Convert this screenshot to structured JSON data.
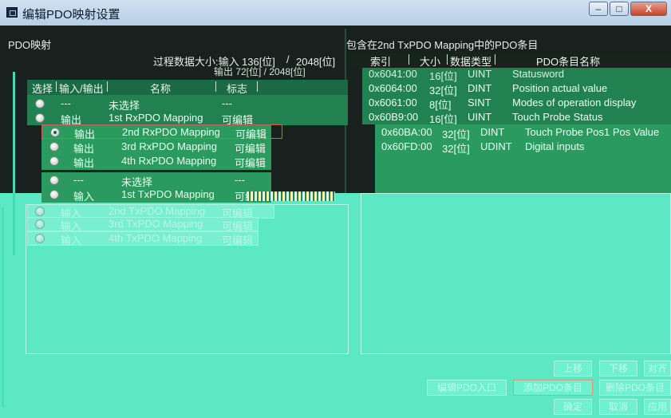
{
  "window": {
    "title": "编辑PDO映射设置",
    "buttons": {
      "minimize": "–",
      "maximize": "□",
      "close": "X"
    }
  },
  "left": {
    "header": "PDO映射",
    "size_label": "过程数据大小:输入",
    "size_value": "136[位]",
    "size_sep": "/",
    "size_max": "2048[位]",
    "overlap_text": "输出 72[位] / 2048[位]",
    "columns": [
      "选择",
      "输入/输出",
      "名称",
      "标志"
    ],
    "rows_top": [
      {
        "io": "---",
        "name": "未选择",
        "flag": "---"
      },
      {
        "io": "输出",
        "name": "1st RxPDO Mapping",
        "flag": "可编辑"
      }
    ],
    "rows_shifted": [
      {
        "io": "输出",
        "name": "2nd RxPDO Mapping",
        "flag": "可编辑",
        "selected": true
      },
      {
        "io": "输出",
        "name": "3rd RxPDO Mapping",
        "flag": "可编辑"
      },
      {
        "io": "输出",
        "name": "4th RxPDO Mapping",
        "flag": "可编辑"
      },
      {
        "io": "---",
        "name": "未选择",
        "flag": "---"
      },
      {
        "io": "输入",
        "name": "1st TxPDO Mapping",
        "flag": "可编辑"
      }
    ],
    "rows_ghost": [
      {
        "io": "输入",
        "name": "2nd TxPDO Mapping",
        "flag": "可编辑"
      },
      {
        "io": "输入",
        "name": "3rd TxPDO Mapping",
        "flag": "可编辑"
      },
      {
        "io": "输入",
        "name": "4th TxPDO Mapping",
        "flag": "可编辑"
      }
    ]
  },
  "right": {
    "header": "包含在2nd TxPDO Mapping中的PDO条目",
    "columns": [
      "索引",
      "大小",
      "数据类型",
      "PDO条目名称"
    ],
    "rows": [
      {
        "index": "0x6041:00",
        "size": "16[位]",
        "type": "UINT",
        "name": "Statusword"
      },
      {
        "index": "0x6064:00",
        "size": "32[位]",
        "type": "DINT",
        "name": "Position actual value"
      },
      {
        "index": "0x6061:00",
        "size": "8[位]",
        "type": "SINT",
        "name": "Modes of operation display"
      },
      {
        "index": "0x60B9:00",
        "size": "16[位]",
        "type": "UINT",
        "name": "Touch Probe Status"
      }
    ],
    "rows_shifted": [
      {
        "index": "0x60BA:00",
        "size": "32[位]",
        "type": "DINT",
        "name": "Touch Probe Pos1 Pos Value"
      },
      {
        "index": "0x60FD:00",
        "size": "32[位]",
        "type": "UDINT",
        "name": "Digital inputs"
      }
    ]
  },
  "buttons": {
    "up": "上移",
    "down": "下移",
    "align": "对齐",
    "edit_entry": "编辑PDO入口",
    "add_entry": "添加PDO条目",
    "delete_entry": "删除PDO条目",
    "ok": "确定",
    "cancel": "取消",
    "apply": "应用"
  },
  "colors": {
    "background": "#5ce8c4",
    "dark_panel": "#18211d",
    "list_green": "#218150",
    "title_bar": "#c3d8ec",
    "selection_border": "#c9645a"
  }
}
